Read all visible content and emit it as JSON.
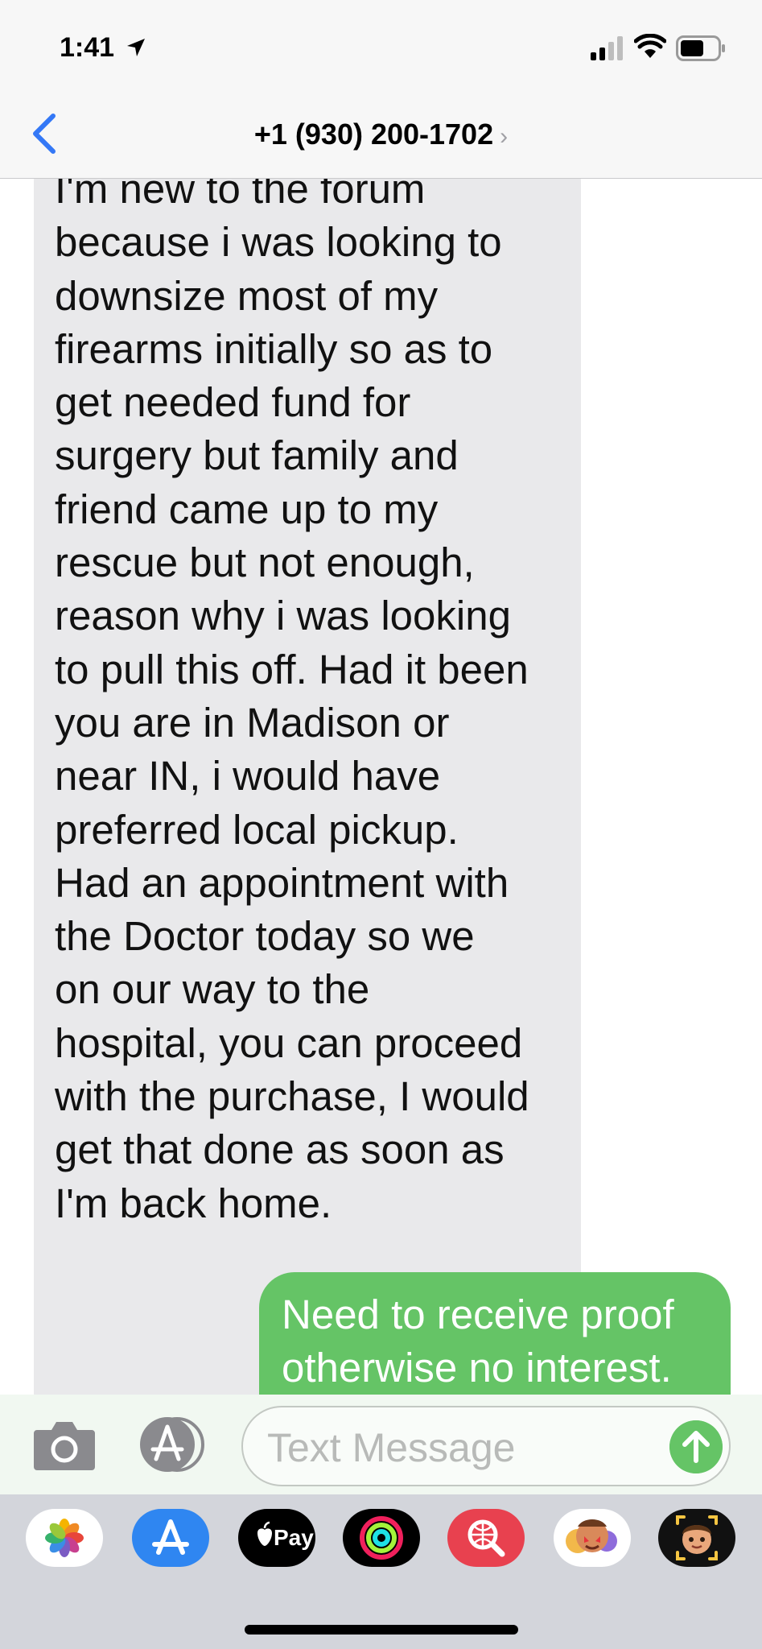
{
  "status_bar": {
    "time": "1:41"
  },
  "nav": {
    "contact": "+1 (930) 200-1702",
    "chevron": "›"
  },
  "messages": [
    {
      "direction": "incoming",
      "text": "I'm new to the  forum\nbecause i was looking to\ndownsize most of my\nfirearms initially so as to\nget needed fund for\nsurgery but family and\nfriend came up to my\nrescue but not enough,\nreason why i was looking\nto pull this off. Had it been\nyou are in Madison or\nnear IN, i would have\npreferred local pickup.\nHad an appointment with\nthe Doctor today so we\non our way to the\nhospital, you can proceed\nwith the purchase, I would\nget that done as soon as\nI'm back home."
    },
    {
      "direction": "outgoing",
      "text": "Need to receive proof\notherwise no interest."
    }
  ],
  "composer": {
    "placeholder": "Text Message"
  },
  "app_drawer": {
    "apple_pay_label": "Pay",
    "apps": [
      "photos-icon",
      "app-store-icon",
      "apple-pay-icon",
      "activity-icon",
      "web-images-icon",
      "memoji-stickers-icon",
      "animoji-icon"
    ]
  },
  "colors": {
    "ios_blue": "#3478f6",
    "imessage_green": "#65c466",
    "incoming_bubble": "#e9e9eb"
  }
}
